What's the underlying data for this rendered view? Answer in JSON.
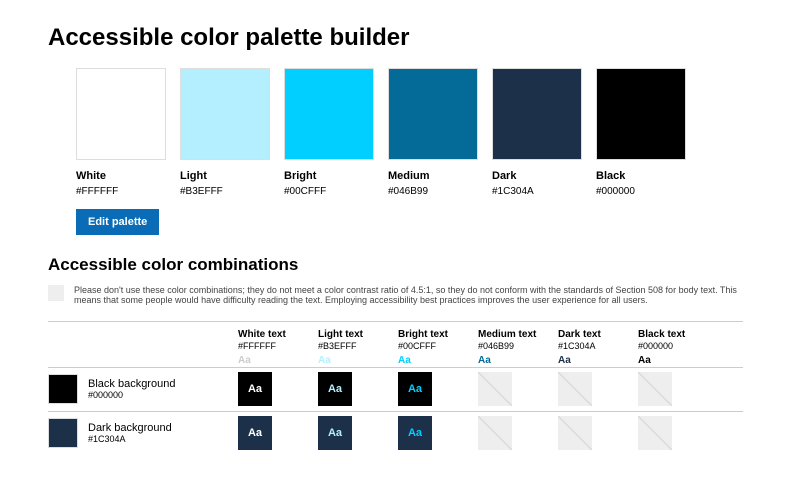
{
  "title": "Accessible color palette builder",
  "swatches": [
    {
      "name": "White",
      "hex": "#FFFFFF",
      "color": "#FFFFFF"
    },
    {
      "name": "Light",
      "hex": "#B3EFFF",
      "color": "#B3EFFF"
    },
    {
      "name": "Bright",
      "hex": "#00CFFF",
      "color": "#00CFFF"
    },
    {
      "name": "Medium",
      "hex": "#046B99",
      "color": "#046B99"
    },
    {
      "name": "Dark",
      "hex": "#1C304A",
      "color": "#1C304A"
    },
    {
      "name": "Black",
      "hex": "#000000",
      "color": "#000000"
    }
  ],
  "edit_button": "Edit palette",
  "combo_title": "Accessible color combinations",
  "disclaimer": "Please don't use these color combinations; they do not meet a color contrast ratio of 4.5:1, so they do not conform with the standards of Section 508 for body text. This means that some people would have difficulty reading the text. Employing accessibility best practices improves the user experience for all users.",
  "columns": [
    {
      "name": "White text",
      "hex": "#FFFFFF",
      "sample_color": "#CCCCCC",
      "sample": "Aa"
    },
    {
      "name": "Light text",
      "hex": "#B3EFFF",
      "sample_color": "#B3EFFF",
      "sample": "Aa"
    },
    {
      "name": "Bright text",
      "hex": "#00CFFF",
      "sample_color": "#00CFFF",
      "sample": "Aa"
    },
    {
      "name": "Medium text",
      "hex": "#046B99",
      "sample_color": "#046B99",
      "sample": "Aa"
    },
    {
      "name": "Dark text",
      "hex": "#1C304A",
      "sample_color": "#1C304A",
      "sample": "Aa"
    },
    {
      "name": "Black text",
      "hex": "#000000",
      "sample_color": "#000000",
      "sample": "Aa"
    }
  ],
  "rows": [
    {
      "name": "Black background",
      "hex": "#000000",
      "bg": "#000000",
      "cells": [
        {
          "ok": true,
          "text": "Aa",
          "fg": "#FFFFFF"
        },
        {
          "ok": true,
          "text": "Aa",
          "fg": "#B3EFFF"
        },
        {
          "ok": true,
          "text": "Aa",
          "fg": "#00CFFF"
        },
        {
          "ok": false
        },
        {
          "ok": false
        },
        {
          "ok": false
        }
      ]
    },
    {
      "name": "Dark background",
      "hex": "#1C304A",
      "bg": "#1C304A",
      "cells": [
        {
          "ok": true,
          "text": "Aa",
          "fg": "#FFFFFF"
        },
        {
          "ok": true,
          "text": "Aa",
          "fg": "#B3EFFF"
        },
        {
          "ok": true,
          "text": "Aa",
          "fg": "#00CFFF"
        },
        {
          "ok": false
        },
        {
          "ok": false
        },
        {
          "ok": false
        }
      ]
    }
  ]
}
